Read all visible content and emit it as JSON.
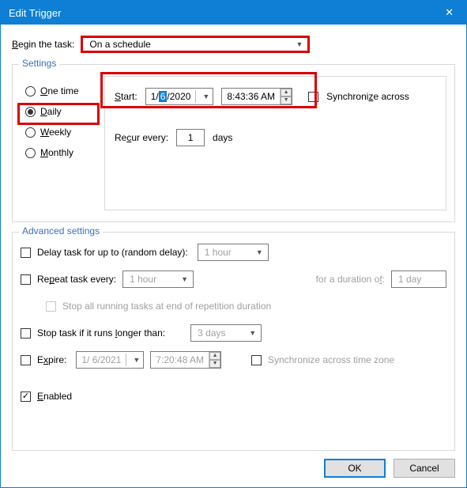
{
  "window": {
    "title": "Edit Trigger"
  },
  "beginTask": {
    "label": "Begin the task:",
    "value": "On a schedule"
  },
  "settings": {
    "legend": "Settings",
    "radios": {
      "onetime": "One time",
      "daily": "Daily",
      "weekly": "Weekly",
      "monthly": "Monthly"
    },
    "startLabel": "Start:",
    "date": {
      "m": "1/",
      "d": "6",
      "y": "/2020"
    },
    "time": "8:43:36 AM",
    "syncLabel": "Synchronize across",
    "recurLabel": "Recur every:",
    "recurValue": "1",
    "recurUnit": "days"
  },
  "advanced": {
    "legend": "Advanced settings",
    "delayLabel": "Delay task for up to (random delay):",
    "delayValue": "1 hour",
    "repeatLabel": "Repeat task every:",
    "repeatValue": "1 hour",
    "durationLabel": "for a duration of:",
    "durationValue": "1 day",
    "stopRepLabel": "Stop all running tasks at end of repetition duration",
    "stopLongLabel": "Stop task if it runs longer than:",
    "stopLongValue": "3 days",
    "expireLabel": "Expire:",
    "expireDate": "1/  6/2021",
    "expireTime": "7:20:48 AM",
    "expireSyncLabel": "Synchronize across time zone",
    "enabledLabel": "Enabled"
  },
  "buttons": {
    "ok": "OK",
    "cancel": "Cancel"
  }
}
